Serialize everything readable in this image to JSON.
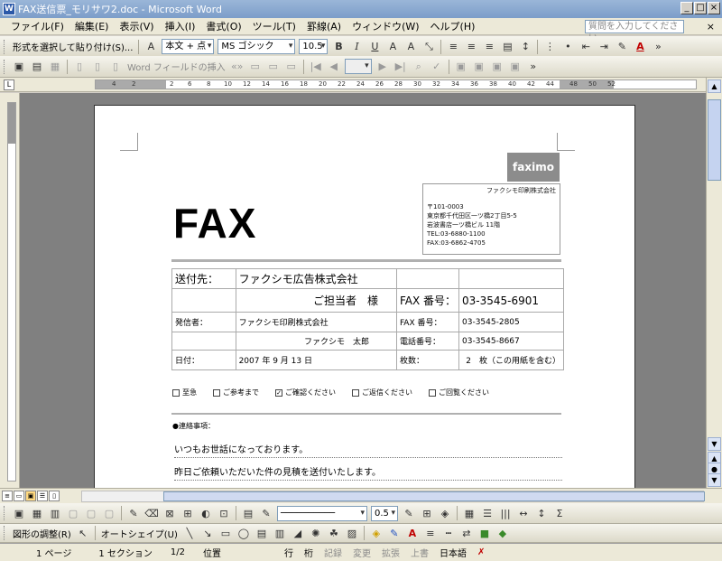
{
  "window": {
    "title": "FAX送信票_モリサワ2.doc - Microsoft Word",
    "app_icon": "W"
  },
  "menu": {
    "items": [
      "ファイル(F)",
      "編集(E)",
      "表示(V)",
      "挿入(I)",
      "書式(O)",
      "ツール(T)",
      "罫線(A)",
      "ウィンドウ(W)",
      "ヘルプ(H)"
    ],
    "help_placeholder": "質問を入力してください"
  },
  "toolbar1": {
    "paste_format": "形式を選択して貼り付け(S)...",
    "style": "本文 + 点",
    "font": "MS ゴシック",
    "size": "10.5"
  },
  "toolbar2": {
    "field": "Word フィールドの挿入"
  },
  "ruler": {
    "ticks": [
      "4",
      "2",
      "2",
      "6",
      "8",
      "10",
      "12",
      "14",
      "16",
      "18",
      "20",
      "22",
      "24",
      "26",
      "28",
      "30",
      "32",
      "34",
      "36",
      "38",
      "40",
      "42",
      "44",
      "48",
      "50",
      "52"
    ]
  },
  "document": {
    "logo": "faximo",
    "company": "ファクシモ印刷株式会社",
    "address_lines": [
      "〒101-0003",
      "東京都千代田区一ツ橋2丁目5-5",
      "岩波書店一ツ橋ビル 11階",
      "TEL:03-6880-1100",
      "FAX:03-6862-4705"
    ],
    "fax_title": "FAX",
    "to_label": "送付先：",
    "to_company": "ファクシモ広告株式会社",
    "to_person": "ご担当者　様",
    "fax_no_label": "FAX 番号：",
    "fax_no": "03-3545-6901",
    "from_label": "発信者：",
    "from_company": "ファクシモ印刷株式会社",
    "from_person": "ファクシモ　太郎",
    "from_fax_label": "FAX 番号：",
    "from_fax": "03-3545-2805",
    "phone_label": "電話番号：",
    "phone": "03-3545-8667",
    "date_label": "日付：",
    "date": "2007 年 9 月 13 日",
    "pages_label": "枚数：",
    "pages": "2　枚（この用紙を含む）",
    "checks": [
      "至急",
      "ご参考まで",
      "ご確認ください",
      "ご返信ください",
      "ご回覧ください"
    ],
    "checked_index": 2,
    "notes_label": "●連絡事項：",
    "note_lines": [
      "いつもお世話になっております。",
      "昨日ご依頼いただいた件の見積を送付いたします。"
    ]
  },
  "drawbar": {
    "adjust": "図形の調整(R)",
    "autoshape": "オートシェイプ(U)",
    "line_width": "0.5"
  },
  "status": {
    "page": "1 ページ",
    "section": "1 セクション",
    "page_of": "1/2",
    "position": "位置",
    "line": "行",
    "col": "桁",
    "rec": "記録",
    "trk": "変更",
    "ext": "拡張",
    "ovr": "上書",
    "language": "日本語"
  },
  "colors": {
    "titlebar": "#7c9dc9",
    "logo_bg": "#8c8c8c",
    "canvas": "#808080"
  }
}
